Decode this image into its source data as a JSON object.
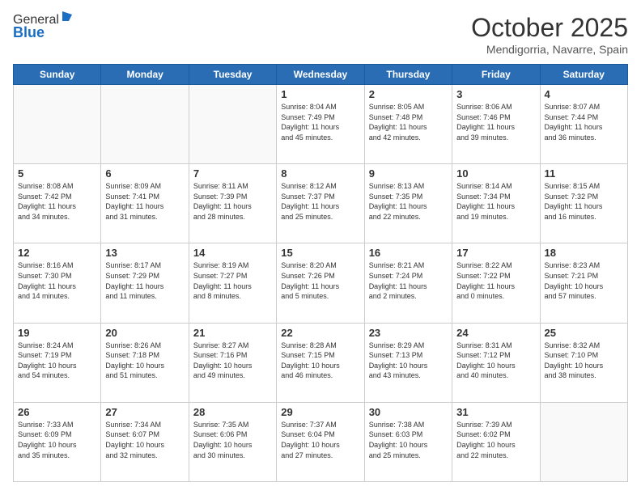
{
  "logo": {
    "line1": "General",
    "line2": "Blue"
  },
  "header": {
    "month": "October 2025",
    "location": "Mendigorria, Navarre, Spain"
  },
  "weekdays": [
    "Sunday",
    "Monday",
    "Tuesday",
    "Wednesday",
    "Thursday",
    "Friday",
    "Saturday"
  ],
  "weeks": [
    [
      {
        "day": "",
        "info": ""
      },
      {
        "day": "",
        "info": ""
      },
      {
        "day": "",
        "info": ""
      },
      {
        "day": "1",
        "info": "Sunrise: 8:04 AM\nSunset: 7:49 PM\nDaylight: 11 hours\nand 45 minutes."
      },
      {
        "day": "2",
        "info": "Sunrise: 8:05 AM\nSunset: 7:48 PM\nDaylight: 11 hours\nand 42 minutes."
      },
      {
        "day": "3",
        "info": "Sunrise: 8:06 AM\nSunset: 7:46 PM\nDaylight: 11 hours\nand 39 minutes."
      },
      {
        "day": "4",
        "info": "Sunrise: 8:07 AM\nSunset: 7:44 PM\nDaylight: 11 hours\nand 36 minutes."
      }
    ],
    [
      {
        "day": "5",
        "info": "Sunrise: 8:08 AM\nSunset: 7:42 PM\nDaylight: 11 hours\nand 34 minutes."
      },
      {
        "day": "6",
        "info": "Sunrise: 8:09 AM\nSunset: 7:41 PM\nDaylight: 11 hours\nand 31 minutes."
      },
      {
        "day": "7",
        "info": "Sunrise: 8:11 AM\nSunset: 7:39 PM\nDaylight: 11 hours\nand 28 minutes."
      },
      {
        "day": "8",
        "info": "Sunrise: 8:12 AM\nSunset: 7:37 PM\nDaylight: 11 hours\nand 25 minutes."
      },
      {
        "day": "9",
        "info": "Sunrise: 8:13 AM\nSunset: 7:35 PM\nDaylight: 11 hours\nand 22 minutes."
      },
      {
        "day": "10",
        "info": "Sunrise: 8:14 AM\nSunset: 7:34 PM\nDaylight: 11 hours\nand 19 minutes."
      },
      {
        "day": "11",
        "info": "Sunrise: 8:15 AM\nSunset: 7:32 PM\nDaylight: 11 hours\nand 16 minutes."
      }
    ],
    [
      {
        "day": "12",
        "info": "Sunrise: 8:16 AM\nSunset: 7:30 PM\nDaylight: 11 hours\nand 14 minutes."
      },
      {
        "day": "13",
        "info": "Sunrise: 8:17 AM\nSunset: 7:29 PM\nDaylight: 11 hours\nand 11 minutes."
      },
      {
        "day": "14",
        "info": "Sunrise: 8:19 AM\nSunset: 7:27 PM\nDaylight: 11 hours\nand 8 minutes."
      },
      {
        "day": "15",
        "info": "Sunrise: 8:20 AM\nSunset: 7:26 PM\nDaylight: 11 hours\nand 5 minutes."
      },
      {
        "day": "16",
        "info": "Sunrise: 8:21 AM\nSunset: 7:24 PM\nDaylight: 11 hours\nand 2 minutes."
      },
      {
        "day": "17",
        "info": "Sunrise: 8:22 AM\nSunset: 7:22 PM\nDaylight: 11 hours\nand 0 minutes."
      },
      {
        "day": "18",
        "info": "Sunrise: 8:23 AM\nSunset: 7:21 PM\nDaylight: 10 hours\nand 57 minutes."
      }
    ],
    [
      {
        "day": "19",
        "info": "Sunrise: 8:24 AM\nSunset: 7:19 PM\nDaylight: 10 hours\nand 54 minutes."
      },
      {
        "day": "20",
        "info": "Sunrise: 8:26 AM\nSunset: 7:18 PM\nDaylight: 10 hours\nand 51 minutes."
      },
      {
        "day": "21",
        "info": "Sunrise: 8:27 AM\nSunset: 7:16 PM\nDaylight: 10 hours\nand 49 minutes."
      },
      {
        "day": "22",
        "info": "Sunrise: 8:28 AM\nSunset: 7:15 PM\nDaylight: 10 hours\nand 46 minutes."
      },
      {
        "day": "23",
        "info": "Sunrise: 8:29 AM\nSunset: 7:13 PM\nDaylight: 10 hours\nand 43 minutes."
      },
      {
        "day": "24",
        "info": "Sunrise: 8:31 AM\nSunset: 7:12 PM\nDaylight: 10 hours\nand 40 minutes."
      },
      {
        "day": "25",
        "info": "Sunrise: 8:32 AM\nSunset: 7:10 PM\nDaylight: 10 hours\nand 38 minutes."
      }
    ],
    [
      {
        "day": "26",
        "info": "Sunrise: 7:33 AM\nSunset: 6:09 PM\nDaylight: 10 hours\nand 35 minutes."
      },
      {
        "day": "27",
        "info": "Sunrise: 7:34 AM\nSunset: 6:07 PM\nDaylight: 10 hours\nand 32 minutes."
      },
      {
        "day": "28",
        "info": "Sunrise: 7:35 AM\nSunset: 6:06 PM\nDaylight: 10 hours\nand 30 minutes."
      },
      {
        "day": "29",
        "info": "Sunrise: 7:37 AM\nSunset: 6:04 PM\nDaylight: 10 hours\nand 27 minutes."
      },
      {
        "day": "30",
        "info": "Sunrise: 7:38 AM\nSunset: 6:03 PM\nDaylight: 10 hours\nand 25 minutes."
      },
      {
        "day": "31",
        "info": "Sunrise: 7:39 AM\nSunset: 6:02 PM\nDaylight: 10 hours\nand 22 minutes."
      },
      {
        "day": "",
        "info": ""
      }
    ]
  ]
}
